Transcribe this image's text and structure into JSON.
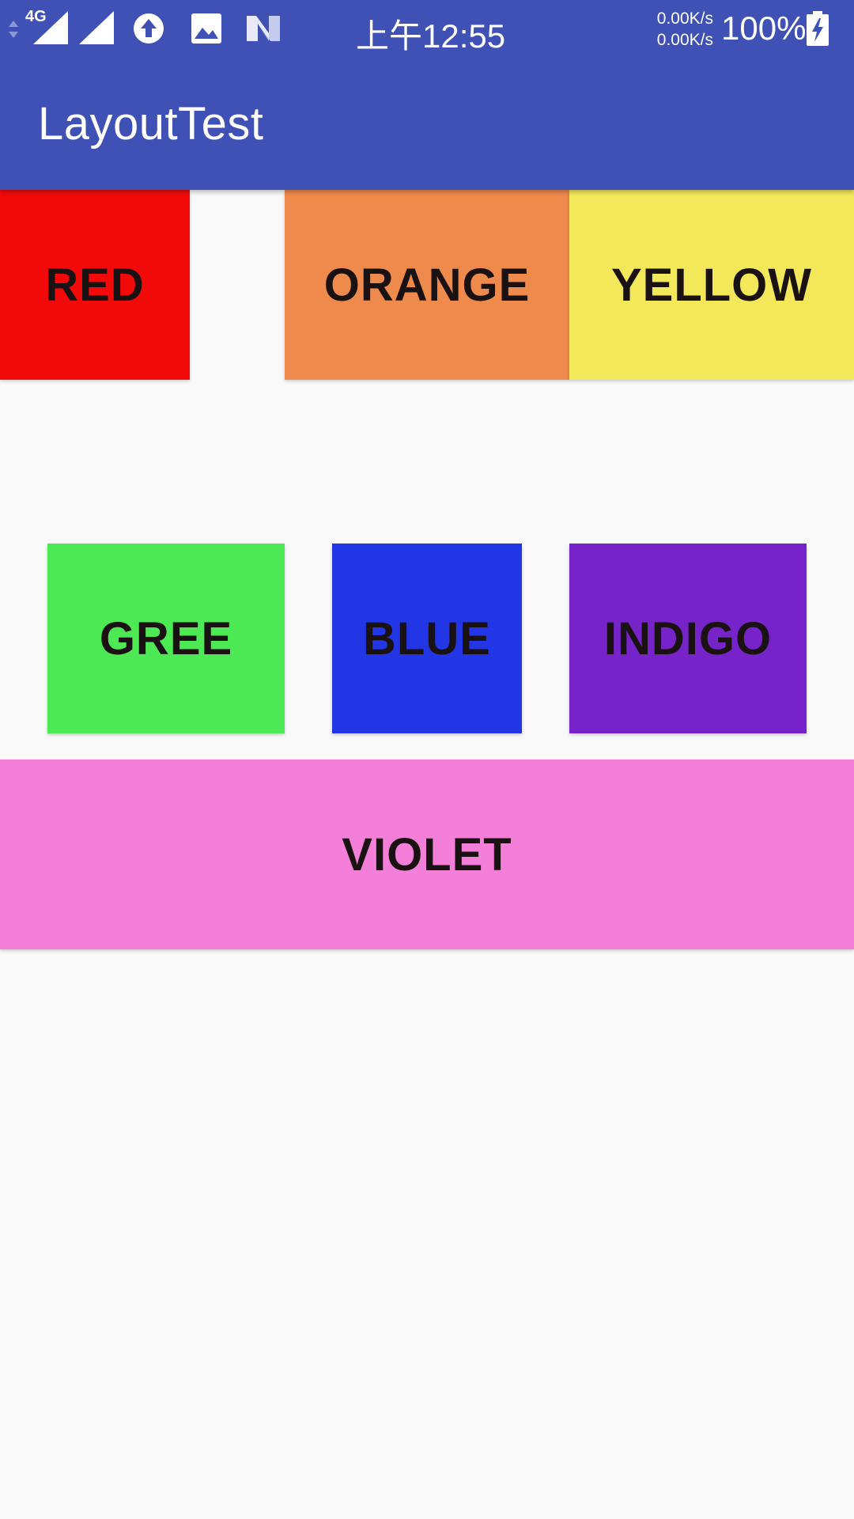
{
  "status_bar": {
    "network_type": "4G",
    "clock": "上午12:55",
    "speed_up": "0.00K/s",
    "speed_down": "0.00K/s",
    "battery": "100%",
    "icons": [
      "signal-icon",
      "signal-icon",
      "upload-icon",
      "image-icon",
      "n-icon",
      "battery-charging-icon"
    ]
  },
  "app_bar": {
    "title": "LayoutTest",
    "color": "#3f51b5"
  },
  "blocks": [
    {
      "label": "RED",
      "color": "#f20a0a"
    },
    {
      "label": "ORANGE",
      "color": "#ee8a4b"
    },
    {
      "label": "YELLOW",
      "color": "#f3e75a"
    },
    {
      "label": "GREE",
      "color": "#4ce954"
    },
    {
      "label": "BLUE",
      "color": "#2336e6"
    },
    {
      "label": "INDIGO",
      "color": "#7624ca"
    },
    {
      "label": "VIOLET",
      "color": "#f37fd9"
    }
  ]
}
